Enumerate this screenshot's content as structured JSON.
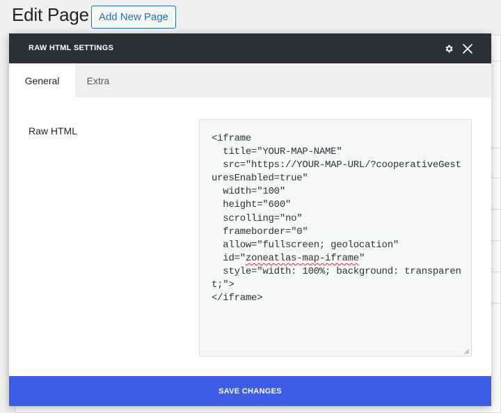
{
  "page": {
    "title": "Edit Page",
    "add_new_label": "Add New Page"
  },
  "modal": {
    "title": "RAW HTML SETTINGS",
    "tabs": [
      {
        "label": "General",
        "active": true
      },
      {
        "label": "Extra",
        "active": false
      }
    ],
    "field_label": "Raw HTML",
    "code_lines_before": [
      "<iframe",
      "  title=\"YOUR-MAP-NAME\"",
      "  src=\"https://YOUR-MAP-URL/?cooperativeGest",
      "uresEnabled=true\"",
      "  width=\"100\"",
      "  height=\"600\"",
      "  scrolling=\"no\"",
      "  frameborder=\"0\"",
      "  allow=\"fullscreen; geolocation\""
    ],
    "code_id_prefix": "  id=\"",
    "code_id_value": "zoneatlas-map-iframe",
    "code_id_suffix": "\"",
    "code_lines_after": [
      "  style=\"width: 100%; background: transparen",
      "t;\">",
      "</iframe>"
    ],
    "save_label": "SAVE CHANGES",
    "icons": {
      "settings": "gear-icon",
      "close": "close-icon"
    },
    "colors": {
      "header_bg": "#2a3038",
      "save_bg": "#3e5de6",
      "link": "#2271b1"
    }
  }
}
